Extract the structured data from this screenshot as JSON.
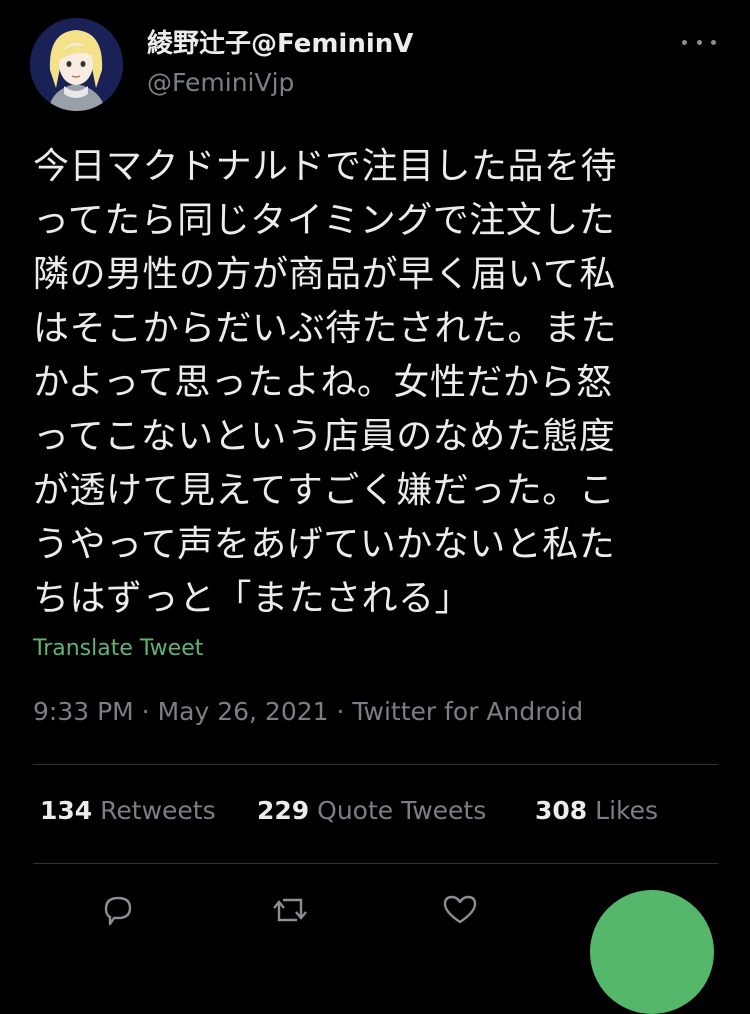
{
  "user": {
    "display_name": "綾野辻子@FemininV",
    "handle": "@FeminiVjp"
  },
  "tweet": {
    "text": "今日マクドナルドで注目した品を待\nってたら同じタイミングで注文した\n隣の男性の方が商品が早く届いて私\nはそこからだいぶ待たされた。また\nかよって思ったよね。女性だから怒\nってこないという店員のなめた態度\nが透けて見えてすごく嫌だった。こ\nうやって声をあげていかないと私た\nちはずっと「またされる」",
    "translate_label": "Translate Tweet",
    "timestamp": "9:33 PM · May 26, 2021 · Twitter for Android"
  },
  "stats": {
    "retweets_count": "134",
    "retweets_label": "Retweets",
    "quotes_count": "229",
    "quotes_label": "Quote Tweets",
    "likes_count": "308",
    "likes_label": "Likes"
  },
  "icons": {
    "more": "more-options-icon",
    "reply": "reply-icon",
    "retweet": "retweet-icon",
    "like": "heart-icon",
    "compose": "compose-icon"
  },
  "colors": {
    "background": "#000000",
    "accent_green": "#54b76a",
    "link_green": "#5fb374",
    "secondary_text": "#7a7f86"
  }
}
